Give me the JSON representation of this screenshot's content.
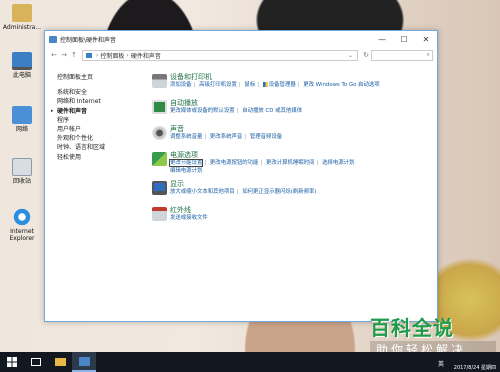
{
  "desktop": {
    "icons": [
      {
        "label": "Administra..."
      },
      {
        "label": "此电脑"
      },
      {
        "label": "网络"
      },
      {
        "label": "回收站"
      },
      {
        "label": "Internet Explorer"
      }
    ]
  },
  "window": {
    "title": "控制面板\\硬件和声音",
    "address": [
      "控制面板",
      "硬件和声音"
    ],
    "address_root_icon": "computer-icon"
  },
  "sidebar": {
    "items": [
      {
        "label": "控制面板主页"
      },
      {
        "label": "系统和安全"
      },
      {
        "label": "网络和 Internet"
      },
      {
        "label": "硬件和声音"
      },
      {
        "label": "程序"
      },
      {
        "label": "用户帐户"
      },
      {
        "label": "外观和个性化"
      },
      {
        "label": "时钟、语言和区域"
      },
      {
        "label": "轻松使用"
      }
    ]
  },
  "categories": [
    {
      "title": "设备和打印机",
      "icon": "printer-icon",
      "links": [
        "添加设备",
        "高级打印机设置",
        "鼠标",
        "设备管理器",
        "更改 Windows To Go 启动选项"
      ]
    },
    {
      "title": "自动播放",
      "icon": "autoplay-icon",
      "links": [
        "更改媒体或设备的默认设置",
        "自动播放 CD 或其他媒体"
      ]
    },
    {
      "title": "声音",
      "icon": "speaker-icon",
      "links": [
        "调整系统音量",
        "更改系统声音",
        "管理音频设备"
      ]
    },
    {
      "title": "电源选项",
      "icon": "power-icon",
      "links": [
        "更改节能设置",
        "更改电源按钮的功能",
        "更改计算机睡眠时间",
        "选择电源计划",
        "编辑电源计划"
      ]
    },
    {
      "title": "显示",
      "icon": "display-icon",
      "links": [
        "放大或缩小文本和其他项目",
        "如何更正显示器闪烁(刷新频率)"
      ]
    },
    {
      "title": "红外线",
      "icon": "infrared-icon",
      "links": [
        "发送或接收文件"
      ]
    }
  ],
  "taskbar": {
    "lang": "英",
    "clock": "2017/8/24 星期四"
  },
  "watermark": {
    "big": "百科全说",
    "small": "助你轻松解决"
  },
  "colors": {
    "category_title": "#1e7145",
    "link": "#1a5fa6",
    "window_border": "#6fa8dc",
    "taskbar": "#111820",
    "watermark": "#1e9b4a"
  }
}
